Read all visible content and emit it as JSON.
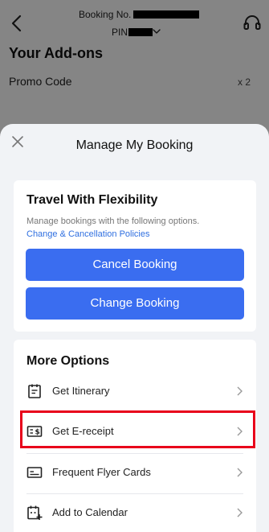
{
  "header": {
    "booking_label": "Booking No.",
    "pin_label": "PIN"
  },
  "background": {
    "title": "Your Add-ons",
    "promo_label": "Promo Code",
    "promo_count": "x 2"
  },
  "sheet": {
    "title": "Manage My Booking",
    "flex": {
      "title": "Travel With Flexibility",
      "subtitle": "Manage bookings with the following options.",
      "link": "Change & Cancellation Policies",
      "cancel_label": "Cancel Booking",
      "change_label": "Change Booking"
    },
    "more": {
      "title": "More Options",
      "items": [
        {
          "label": "Get Itinerary",
          "icon": "itinerary-icon"
        },
        {
          "label": "Get E-receipt",
          "icon": "receipt-icon"
        },
        {
          "label": "Frequent Flyer Cards",
          "icon": "card-icon"
        },
        {
          "label": "Add to Calendar",
          "icon": "calendar-add-icon"
        }
      ]
    }
  },
  "colors": {
    "primary": "#3a6df0",
    "link": "#2f6fe0",
    "highlight": "#e8001b"
  }
}
